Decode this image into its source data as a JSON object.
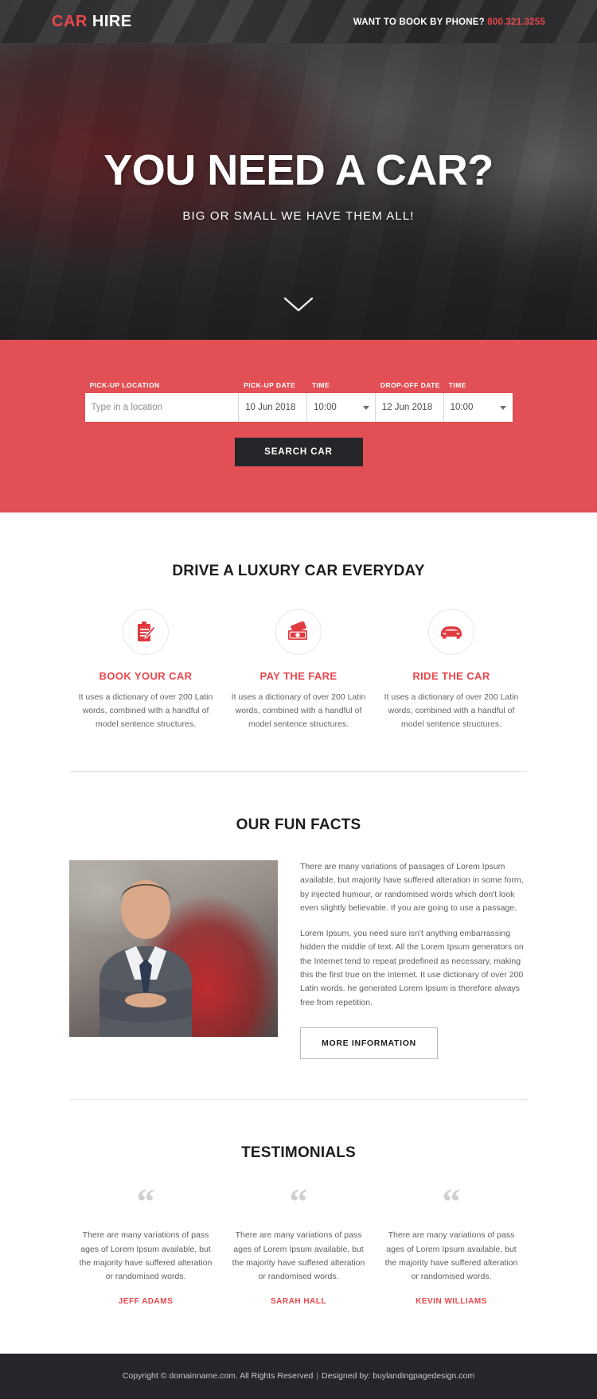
{
  "header": {
    "logo_part1": "CAR",
    "logo_part2": "HIRE",
    "phone_label": "WANT TO BOOK BY PHONE?",
    "phone_number": "800.321.3255"
  },
  "hero": {
    "title": "YOU NEED A CAR?",
    "subtitle": "BIG OR SMALL WE HAVE THEM ALL!",
    "scroll_icon": "chevron-down-icon"
  },
  "booking": {
    "labels": {
      "pickup_location": "PICK-UP LOCATION",
      "pickup_date": "PICK-UP DATE",
      "pickup_time": "TIME",
      "dropoff_date": "DROP-OFF DATE",
      "dropoff_time": "TIME"
    },
    "values": {
      "location_placeholder": "Type in a location",
      "pickup_date": "10 Jun 2018",
      "pickup_time": "10:00",
      "dropoff_date": "12 Jun 2018",
      "dropoff_time": "10:00"
    },
    "search_label": "SEARCH CAR",
    "accent_color": "#e25055"
  },
  "features": {
    "title": "DRIVE A LUXURY CAR EVERYDAY",
    "items": [
      {
        "icon": "clipboard-pencil-icon",
        "title": "BOOK YOUR CAR",
        "text": "It uses a dictionary of over 200 Latin words, combined with a handful of model sentence structures."
      },
      {
        "icon": "money-cash-icon",
        "title": "PAY THE FARE",
        "text": "It uses a dictionary of over 200 Latin words, combined with a handful of model sentence structures."
      },
      {
        "icon": "car-icon",
        "title": "RIDE THE CAR",
        "text": "It uses a dictionary of over 200 Latin words, combined with a handful of model sentence structures."
      }
    ]
  },
  "funfacts": {
    "title": "OUR FUN FACTS",
    "paragraph1": "There are many variations of passages of Lorem Ipsum available, but majority have suffered alteration in some form, by injected humour, or randomised words which don't look even slightly believable. If you are going to use a passage.",
    "paragraph2": "Lorem Ipsum, you need sure isn't anything embarrassing hidden the middle of text. All the Lorem Ipsum generators on the Internet tend to repeat predefined as necessary, making this the first true on the Internet. It use dictionary of over 200 Latin words. he generated Lorem Ipsum is therefore always free from repetition.",
    "button_label": "MORE INFORMATION",
    "image_alt": "smiling-businessman-beside-cars"
  },
  "testimonials": {
    "title": "TESTIMONIALS",
    "quote_glyph": "“",
    "items": [
      {
        "text": "There are many variations of pass ages of Lorem Ipsum available, but the majority have suffered alteration or randomised words.",
        "name": "JEFF ADAMS"
      },
      {
        "text": "There are many variations of pass ages of Lorem Ipsum available, but the majority have suffered alteration or randomised words.",
        "name": "SARAH HALL"
      },
      {
        "text": "There are many variations of pass ages of Lorem Ipsum available, but the majority have suffered alteration or randomised words.",
        "name": "KEVIN WILLIAMS"
      }
    ]
  },
  "footer": {
    "copyright": "Copyright © domainname.com. All Rights Reserved",
    "separator": "|",
    "designed_by": "Designed by: buylandingpagedesign.com"
  }
}
